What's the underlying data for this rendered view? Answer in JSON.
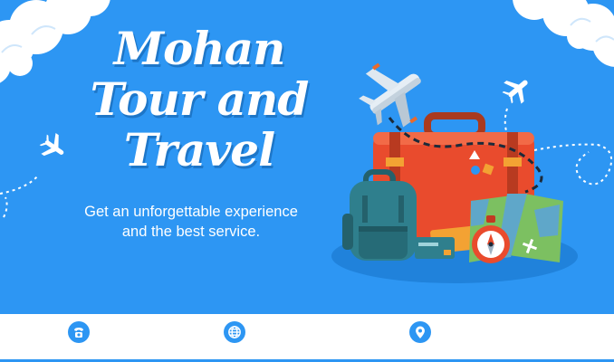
{
  "brand": {
    "title_lines": [
      "Mohan",
      "Tour and",
      "Travel"
    ]
  },
  "tagline": {
    "lines": [
      "Get an unforgettable experience",
      "and the best service."
    ]
  },
  "footer": {
    "icons": [
      "phone-icon",
      "globe-icon",
      "location-pin-icon"
    ]
  },
  "colors": {
    "background": "#2d96f3",
    "suitcase": "#e94b2d",
    "backpack": "#2f7f8d",
    "map": "#7cc061",
    "footer": "#ffffff"
  }
}
